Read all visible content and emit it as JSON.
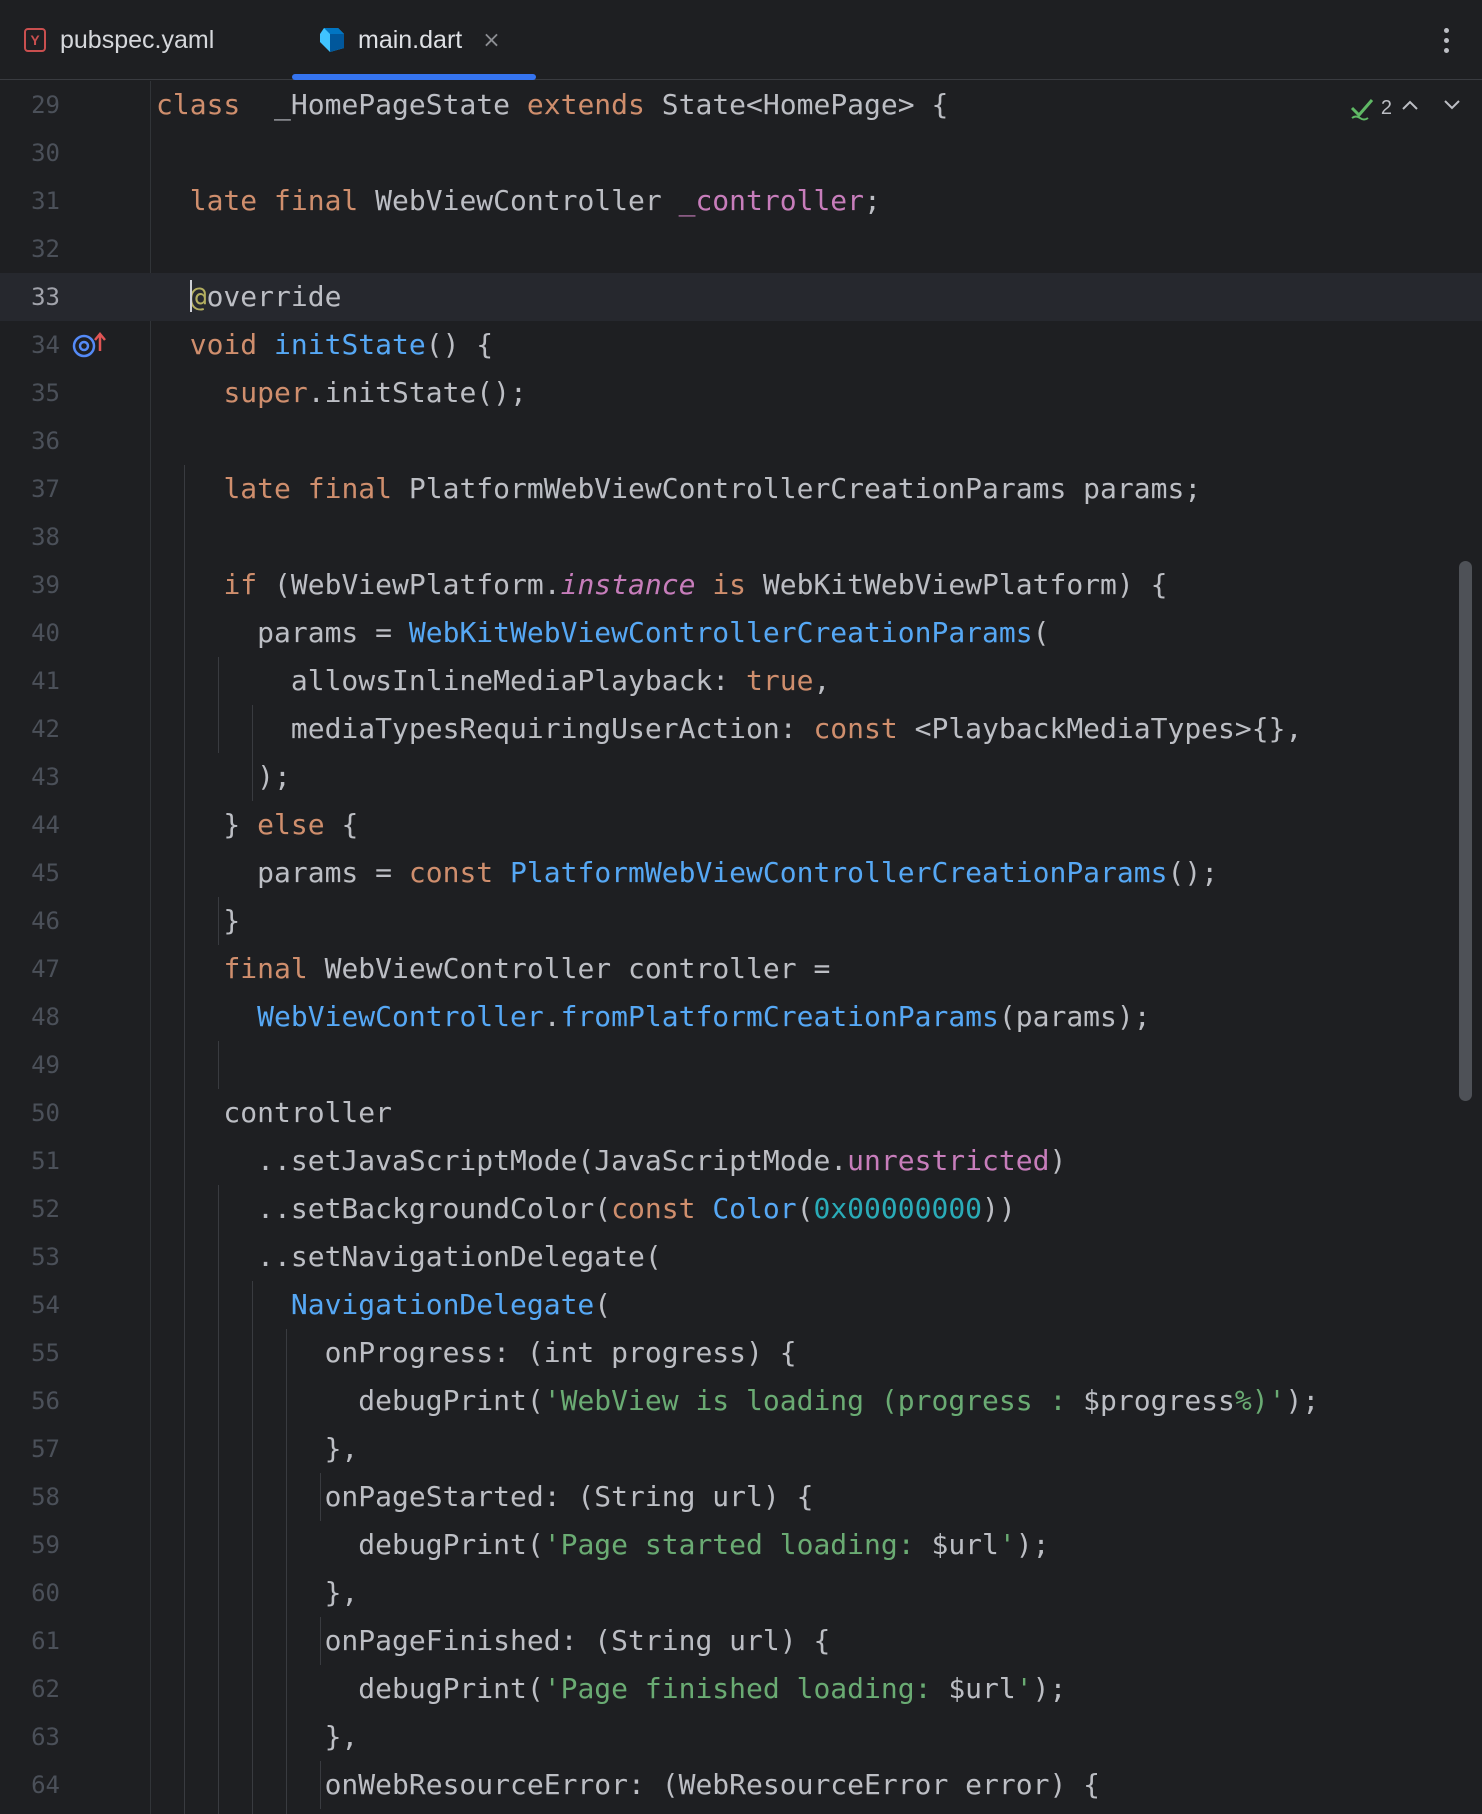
{
  "tabs": [
    {
      "label": "pubspec.yaml",
      "icon": "yaml-file-icon",
      "active": false
    },
    {
      "label": "main.dart",
      "icon": "dart-file-icon",
      "active": true
    }
  ],
  "inspection": {
    "count": "2"
  },
  "colors": {
    "background": "#1e1f22",
    "keyword": "#cf8e6d",
    "function": "#56a8f5",
    "field": "#c77dbb",
    "string": "#6aab73",
    "number": "#2aacb8",
    "annotation": "#b3ae60",
    "accent": "#3574f0"
  },
  "editor": {
    "current_line": "33",
    "lines": [
      {
        "num": "29",
        "segments": [
          [
            "kw",
            "class"
          ],
          [
            "",
            "  _HomePageState "
          ],
          [
            "kw",
            "extends"
          ],
          [
            "",
            " State<HomePage> {"
          ]
        ]
      },
      {
        "num": "30",
        "segments": []
      },
      {
        "num": "31",
        "segments": [
          [
            "",
            "  "
          ],
          [
            "kw",
            "late final"
          ],
          [
            "",
            " WebViewController "
          ],
          [
            "field",
            "_controller"
          ],
          [
            "",
            ";"
          ]
        ]
      },
      {
        "num": "32",
        "segments": []
      },
      {
        "num": "33",
        "segments": [
          [
            "",
            "  "
          ],
          [
            "caret",
            ""
          ],
          [
            "ann",
            "@"
          ],
          [
            "",
            "override"
          ]
        ]
      },
      {
        "num": "34",
        "segments": [
          [
            "",
            "  "
          ],
          [
            "kw",
            "void"
          ],
          [
            "",
            " "
          ],
          [
            "fn",
            "initState"
          ],
          [
            "",
            "() {"
          ]
        ]
      },
      {
        "num": "35",
        "segments": [
          [
            "",
            "    "
          ],
          [
            "kw",
            "super"
          ],
          [
            "",
            ".initState();"
          ]
        ]
      },
      {
        "num": "36",
        "segments": []
      },
      {
        "num": "37",
        "segments": [
          [
            "",
            "    "
          ],
          [
            "kw",
            "late final"
          ],
          [
            "",
            " PlatformWebViewControllerCreationParams params;"
          ]
        ]
      },
      {
        "num": "38",
        "segments": []
      },
      {
        "num": "39",
        "segments": [
          [
            "",
            "    "
          ],
          [
            "kw",
            "if"
          ],
          [
            "",
            " (WebViewPlatform."
          ],
          [
            "it",
            "instance"
          ],
          [
            "",
            " "
          ],
          [
            "kw",
            "is"
          ],
          [
            "",
            " WebKitWebViewPlatform) {"
          ]
        ]
      },
      {
        "num": "40",
        "segments": [
          [
            "",
            "      params = "
          ],
          [
            "cls",
            "WebKitWebViewControllerCreationParams"
          ],
          [
            "",
            "("
          ]
        ]
      },
      {
        "num": "41",
        "segments": [
          [
            "",
            "        allowsInlineMediaPlayback: "
          ],
          [
            "kw",
            "true"
          ],
          [
            "",
            ","
          ]
        ]
      },
      {
        "num": "42",
        "segments": [
          [
            "",
            "        mediaTypesRequiringUserAction: "
          ],
          [
            "kw",
            "const"
          ],
          [
            "",
            " <PlaybackMediaTypes>{},"
          ]
        ]
      },
      {
        "num": "43",
        "segments": [
          [
            "",
            "      );"
          ]
        ]
      },
      {
        "num": "44",
        "segments": [
          [
            "",
            "    } "
          ],
          [
            "kw",
            "else"
          ],
          [
            "",
            " {"
          ]
        ]
      },
      {
        "num": "45",
        "segments": [
          [
            "",
            "      params = "
          ],
          [
            "kw",
            "const"
          ],
          [
            "",
            " "
          ],
          [
            "cls",
            "PlatformWebViewControllerCreationParams"
          ],
          [
            "",
            "();"
          ]
        ]
      },
      {
        "num": "46",
        "segments": [
          [
            "",
            "    }"
          ]
        ]
      },
      {
        "num": "47",
        "segments": [
          [
            "",
            "    "
          ],
          [
            "kw",
            "final"
          ],
          [
            "",
            " WebViewController controller ="
          ]
        ]
      },
      {
        "num": "48",
        "segments": [
          [
            "",
            "      "
          ],
          [
            "cls",
            "WebViewController"
          ],
          [
            "",
            "."
          ],
          [
            "fn",
            "fromPlatformCreationParams"
          ],
          [
            "",
            "(params);"
          ]
        ]
      },
      {
        "num": "49",
        "segments": []
      },
      {
        "num": "50",
        "segments": [
          [
            "",
            "    controller"
          ]
        ]
      },
      {
        "num": "51",
        "segments": [
          [
            "",
            "      ..setJavaScriptMode(JavaScriptMode."
          ],
          [
            "field",
            "unrestricted"
          ],
          [
            "",
            ")"
          ]
        ]
      },
      {
        "num": "52",
        "segments": [
          [
            "",
            "      ..setBackgroundColor("
          ],
          [
            "kw",
            "const"
          ],
          [
            "",
            " "
          ],
          [
            "cls",
            "Color"
          ],
          [
            "",
            "("
          ],
          [
            "num",
            "0x00000000"
          ],
          [
            "",
            "))"
          ]
        ]
      },
      {
        "num": "53",
        "segments": [
          [
            "",
            "      ..setNavigationDelegate("
          ]
        ]
      },
      {
        "num": "54",
        "segments": [
          [
            "",
            "        "
          ],
          [
            "cls",
            "NavigationDelegate"
          ],
          [
            "",
            "("
          ]
        ]
      },
      {
        "num": "55",
        "segments": [
          [
            "",
            "          onProgress: (int progress) {"
          ]
        ]
      },
      {
        "num": "56",
        "segments": [
          [
            "",
            "            debugPrint("
          ],
          [
            "str",
            "'WebView is loading (progress : "
          ],
          [
            "",
            "$progress"
          ],
          [
            "str",
            "%)'"
          ],
          [
            "",
            ");"
          ]
        ]
      },
      {
        "num": "57",
        "segments": [
          [
            "",
            "          },"
          ]
        ]
      },
      {
        "num": "58",
        "segments": [
          [
            "",
            "          onPageStarted: (String url) {"
          ]
        ]
      },
      {
        "num": "59",
        "segments": [
          [
            "",
            "            debugPrint("
          ],
          [
            "str",
            "'Page started loading: "
          ],
          [
            "",
            "$url"
          ],
          [
            "str",
            "'"
          ],
          [
            "",
            ");"
          ]
        ]
      },
      {
        "num": "60",
        "segments": [
          [
            "",
            "          },"
          ]
        ]
      },
      {
        "num": "61",
        "segments": [
          [
            "",
            "          onPageFinished: (String url) {"
          ]
        ]
      },
      {
        "num": "62",
        "segments": [
          [
            "",
            "            debugPrint("
          ],
          [
            "str",
            "'Page finished loading: "
          ],
          [
            "",
            "$url"
          ],
          [
            "str",
            "'"
          ],
          [
            "",
            ");"
          ]
        ]
      },
      {
        "num": "63",
        "segments": [
          [
            "",
            "          },"
          ]
        ]
      },
      {
        "num": "64",
        "segments": [
          [
            "",
            "          onWebResourceError: (WebResourceError error) {"
          ]
        ]
      }
    ]
  }
}
